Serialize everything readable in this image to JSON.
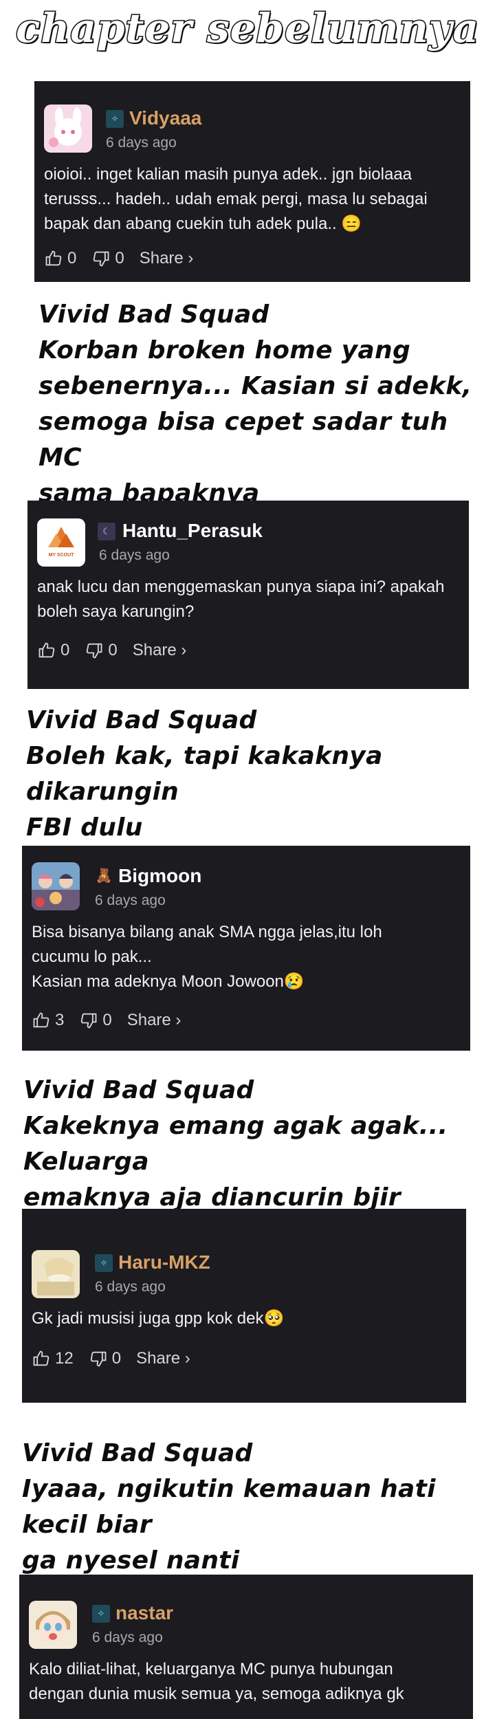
{
  "title": "chapter sebelumnya",
  "comments": [
    {
      "username": "Vidyaaa",
      "username_color": "#d9a066",
      "time": "6 days ago",
      "text": "oioioi.. inget kalian masih punya adek.. jgn biolaaa\nterusss... hadeh.. udah emak pergi, masa lu sebagai\nbapak dan abang cuekin tuh adek pula.. 😑",
      "likes": "0",
      "dislikes": "0",
      "share": "Share ›"
    },
    {
      "username": "Hantu_Perasuk",
      "username_color": "#ffffff",
      "avatar_text": "MY SCOUT",
      "time": "6 days ago",
      "text": "anak lucu dan menggemaskan punya siapa ini? apakah\nboleh saya karungin?",
      "likes": "0",
      "dislikes": "0",
      "share": "Share ›"
    },
    {
      "username": "Bigmoon",
      "username_color": "#ffffff",
      "time": "6 days ago",
      "text": "Bisa bisanya bilang anak SMA ngga jelas,itu loh\ncucumu lo pak...\nKasian ma adeknya Moon Jowoon😢",
      "likes": "3",
      "dislikes": "0",
      "share": "Share ›"
    },
    {
      "username": "Haru-MKZ",
      "username_color": "#d9a066",
      "time": "6 days ago",
      "text": "Gk jadi musisi juga gpp kok dek🥺",
      "likes": "12",
      "dislikes": "0",
      "share": "Share ›"
    },
    {
      "username": "nastar",
      "username_color": "#d9a066",
      "time": "6 days ago",
      "text": "Kalo diliat-lihat, keluarganya MC punya hubungan\ndengan dunia musik semua ya, semoga adiknya gk",
      "likes": "",
      "dislikes": "",
      "share": ""
    }
  ],
  "replies": [
    "Vivid Bad Squad\nKorban broken home yang\nsebenernya... Kasian si adekk,\nsemoga bisa cepet sadar tuh MC\nsama bapaknya",
    "Vivid Bad Squad\nBoleh kak, tapi kakaknya dikarungin\nFBI dulu",
    "Vivid Bad Squad\nKakeknya emang agak agak... Keluarga\nemaknya aja diancurin bjir",
    "Vivid Bad Squad\nIyaaa, ngikutin kemauan hati kecil biar\nga nyesel nanti"
  ],
  "icons": {
    "like": "thumbs-up-icon",
    "dislike": "thumbs-down-icon"
  },
  "colors": {
    "card_bg": "#1b1b20",
    "meta_gray": "#a8a8ae",
    "accent_gold": "#d9a066"
  }
}
